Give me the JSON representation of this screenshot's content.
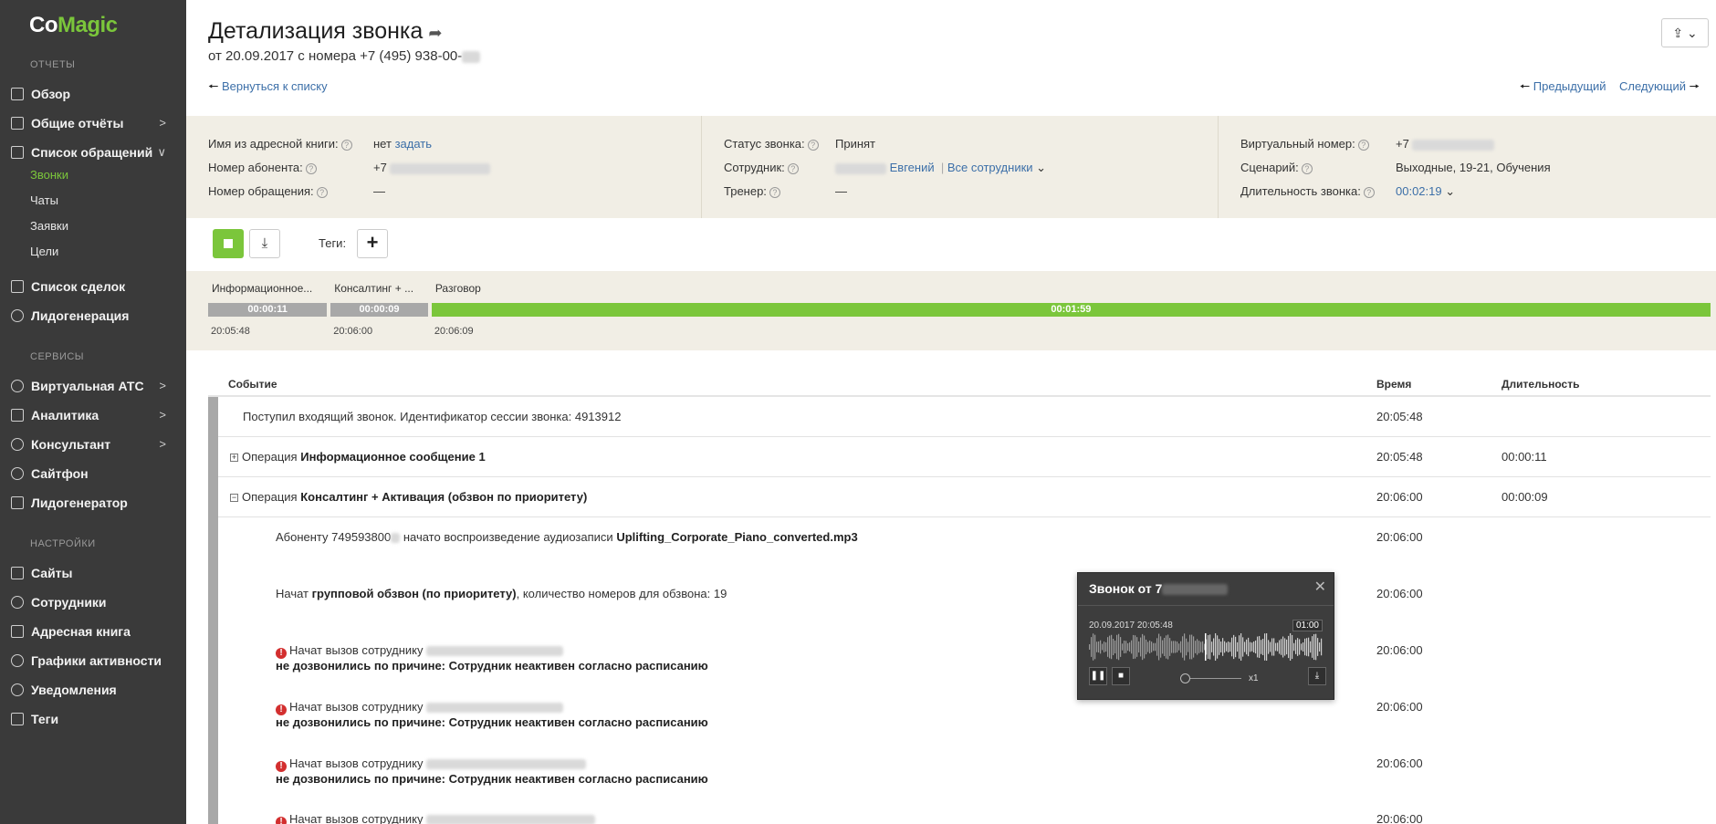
{
  "app": {
    "logo_co": "Co",
    "logo_magic": "Magic"
  },
  "sidebar": {
    "section_reports": "ОТЧЕТЫ",
    "section_services": "СЕРВИСЫ",
    "section_settings": "НАСТРОЙКИ",
    "items": [
      {
        "label": "Обзор",
        "icon": "chart-icon"
      },
      {
        "label": "Общие отчёты",
        "icon": "grid-icon",
        "chevron": ">"
      },
      {
        "label": "Список обращений",
        "icon": "list-icon",
        "chevron": "v"
      },
      {
        "label": "Список сделок",
        "icon": "cart-icon"
      },
      {
        "label": "Лидогенерация",
        "icon": "target-icon"
      },
      {
        "label": "Виртуальная АТС",
        "icon": "phone-icon",
        "chevron": ">"
      },
      {
        "label": "Аналитика",
        "icon": "analytics-icon",
        "chevron": ">"
      },
      {
        "label": "Консультант",
        "icon": "chat-icon",
        "chevron": ">"
      },
      {
        "label": "Сайтфон",
        "icon": "sitephone-icon"
      },
      {
        "label": "Лидогенератор",
        "icon": "leadgen-icon"
      },
      {
        "label": "Сайты",
        "icon": "sites-icon"
      },
      {
        "label": "Сотрудники",
        "icon": "users-icon"
      },
      {
        "label": "Адресная книга",
        "icon": "book-icon"
      },
      {
        "label": "Графики активности",
        "icon": "clock-icon"
      },
      {
        "label": "Уведомления",
        "icon": "bell-icon"
      },
      {
        "label": "Теги",
        "icon": "tag-icon"
      }
    ],
    "subitems": [
      "Звонки",
      "Чаты",
      "Заявки",
      "Цели"
    ],
    "active_subitem": "Звонки"
  },
  "header": {
    "title": "Детализация звонка",
    "subtitle": "от 20.09.2017 с номера +7 (495) 938-00-",
    "back_link": "Вернуться к списку",
    "prev_link": "Предыдущий",
    "next_link": "Следующий"
  },
  "info": {
    "col1": [
      {
        "label": "Имя из адресной книги:",
        "value": "нет",
        "link": "задать"
      },
      {
        "label": "Номер абонента:",
        "value": "+7"
      },
      {
        "label": "Номер обращения:",
        "value": "—"
      }
    ],
    "col2": [
      {
        "label": "Статус звонка:",
        "value": "Принят"
      },
      {
        "label": "Сотрудник:",
        "value": "Евгений",
        "link": "Все сотрудники"
      },
      {
        "label": "Тренер:",
        "value": "—"
      }
    ],
    "col3": [
      {
        "label": "Виртуальный номер:",
        "value": "+7"
      },
      {
        "label": "Сценарий:",
        "value": "Выходные, 19-21, Обучения"
      },
      {
        "label": "Длительность звонка:",
        "value": "00:02:19"
      }
    ]
  },
  "toolbar": {
    "tags_label": "Теги:"
  },
  "timeline": {
    "segments": [
      {
        "name": "Информационное...",
        "duration": "00:00:11",
        "start": "20:05:48",
        "color": "#a8a8a8",
        "seconds": 11
      },
      {
        "name": "Консалтинг + ...",
        "duration": "00:00:09",
        "start": "20:06:00",
        "color": "#a8a8a8",
        "seconds": 9
      },
      {
        "name": "Разговор",
        "duration": "00:01:59",
        "start": "20:06:09",
        "color": "#7bc63b",
        "seconds": 119
      }
    ]
  },
  "events": {
    "headers": {
      "event": "Событие",
      "time": "Время",
      "duration": "Длительность"
    },
    "rows": [
      {
        "text": "Поступил входящий звонок. Идентификатор сессии звонка: 4913912",
        "time": "20:05:48",
        "duration": ""
      },
      {
        "prefix": "Операция",
        "bold": "Информационное сообщение 1",
        "toggle": "+",
        "time": "20:05:48",
        "duration": "00:00:11"
      },
      {
        "prefix": "Операция",
        "bold": "Консалтинг + Активация (обзвон по приоритету)",
        "toggle": "−",
        "time": "20:06:00",
        "duration": "00:00:09"
      },
      {
        "pre": "Абоненту 749593800",
        "mid": "начато воспроизведение аудиозаписи",
        "bold": "Uplifting_Corporate_Piano_converted.mp3",
        "time": "20:06:00"
      },
      {
        "pre": "Начат",
        "bold": "групповой обзвон (по приоритету)",
        "post": ", количество номеров для обзвона: 19",
        "time": "20:06:00"
      },
      {
        "line1": "Начат вызов сотруднику",
        "line2": "не дозвонились по причине: Сотрудник неактивен согласно расписанию",
        "time": "20:06:00"
      },
      {
        "line1": "Начат вызов сотруднику",
        "line2": "не дозвонились по причине: Сотрудник неактивен согласно расписанию",
        "time": "20:06:00"
      },
      {
        "line1": "Начат вызов сотруднику",
        "line2": "не дозвонились по причине: Сотрудник неактивен согласно расписанию",
        "time": "20:06:00"
      },
      {
        "line1": "Начат вызов сотруднику",
        "time": "20:06:00"
      }
    ]
  },
  "player": {
    "title": "Звонок от 7",
    "date": "20.09.2017 20:05:48",
    "position": "01:00",
    "speed": "x1"
  }
}
